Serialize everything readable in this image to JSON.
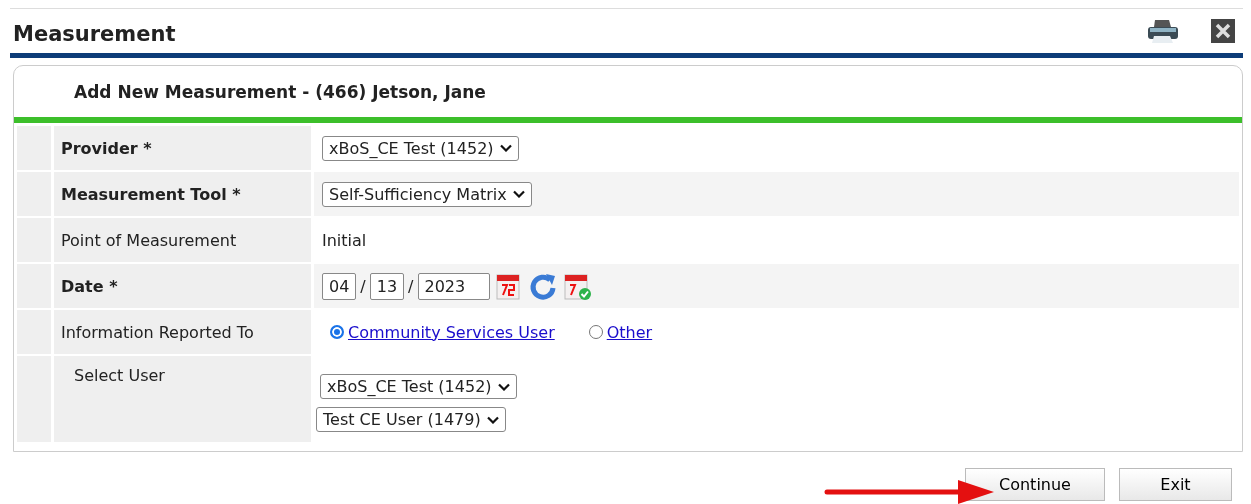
{
  "page": {
    "title": "Measurement"
  },
  "form": {
    "title": "Add New Measurement - (466) Jetson, Jane",
    "rows": [
      {
        "kind": "select",
        "label": "Provider *",
        "required": true,
        "values": [
          "xBoS_CE Test (1452)"
        ]
      },
      {
        "kind": "select",
        "label": "Measurement Tool *",
        "required": true,
        "values": [
          "Self-Sufficiency Matrix"
        ]
      },
      {
        "kind": "text",
        "label": "Point of Measurement",
        "required": false,
        "value": "Initial"
      },
      {
        "kind": "date",
        "label": "Date *",
        "required": true,
        "separator": "/",
        "month": "04",
        "day": "13",
        "year": "2023"
      },
      {
        "kind": "radio",
        "label": "Information Reported To",
        "required": false,
        "options": [
          {
            "label": "Community Services User",
            "selected": true
          },
          {
            "label": "Other",
            "selected": false
          }
        ]
      },
      {
        "kind": "select",
        "label": "Select User",
        "required": false,
        "indented": true,
        "values": [
          "xBoS_CE Test (1452)",
          "Test CE User (1479)"
        ]
      }
    ]
  },
  "buttons": [
    "Continue",
    "Exit"
  ]
}
